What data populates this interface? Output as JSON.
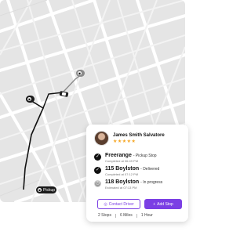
{
  "map": {
    "pins": [
      {
        "icon": "camera-icon",
        "label": ""
      },
      {
        "icon": "camera-icon",
        "label": ""
      },
      {
        "icon": "pickup-icon",
        "label": "Pickup"
      }
    ]
  },
  "driver": {
    "name": "James Smith Salvatore",
    "stars": "★★★★★"
  },
  "stops": [
    {
      "name": "Freerange",
      "status": "- Pickup Stop",
      "time": "Completed at 06:49 PM",
      "state": "done"
    },
    {
      "name": "115 Boylston",
      "status": "- Delivered",
      "time": "Completed at 07:12 PM",
      "state": "done"
    },
    {
      "name": "118 Boylston",
      "status": "- In progress",
      "time": "Estimated at 07:13 PM",
      "state": "progress"
    }
  ],
  "actions": {
    "contact_label": "Contact Driver",
    "add_label": "Add Stop"
  },
  "summary": {
    "stops": "2 Stops",
    "miles": "6 Miles",
    "duration": "1 Hour"
  },
  "colors": {
    "accent": "#7b3fe4",
    "star": "#f5a623",
    "route": "#111111"
  }
}
